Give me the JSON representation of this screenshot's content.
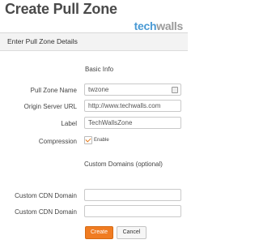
{
  "page": {
    "title": "Create Pull Zone"
  },
  "logo": {
    "part1": "tech",
    "part2": "walls"
  },
  "panel": {
    "header": "Enter Pull Zone Details",
    "basic_info": {
      "title": "Basic Info",
      "pull_zone_name": {
        "label": "Pull Zone Name",
        "value": "twzone"
      },
      "origin_server_url": {
        "label": "Origin Server URL",
        "value": "http://www.techwalls.com"
      },
      "label": {
        "label": "Label",
        "value": "TechWallsZone"
      },
      "compression": {
        "label": "Compression",
        "checkbox_label": "Enable",
        "checked": true
      }
    },
    "custom_domains": {
      "title": "Custom Domains (optional)",
      "fields": [
        {
          "label": "Custom CDN Domain",
          "value": ""
        },
        {
          "label": "Custom CDN Domain",
          "value": ""
        }
      ]
    },
    "buttons": {
      "create": "Create",
      "cancel": "Cancel"
    }
  },
  "colors": {
    "accent": "#f07c22",
    "logo_blue": "#4a9ad4",
    "logo_gray": "#9a9a9a"
  }
}
